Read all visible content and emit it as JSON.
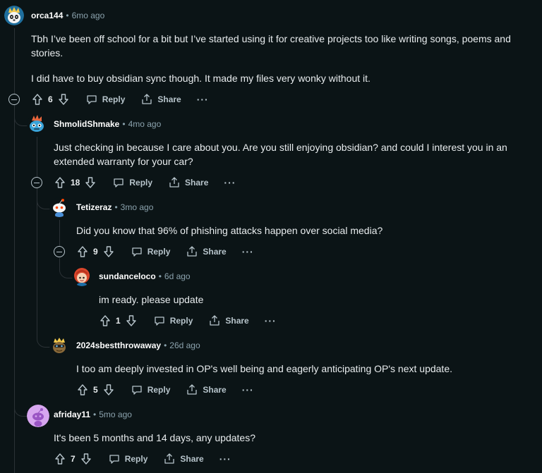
{
  "comments": [
    {
      "username": "orca144",
      "time": "6mo ago",
      "avatar_icon": "panda-avatar-icon",
      "paragraphs": [
        "Tbh I’ve been off school for a bit but I’ve started using it for creative projects too like writing songs, poems and stories.",
        "I did have to buy obsidian sync though. It made my files very wonky without it."
      ],
      "votes": "6"
    },
    {
      "username": "ShmolidShmake",
      "time": "4mo ago",
      "avatar_icon": "robot-avatar-icon",
      "paragraphs": [
        "Just checking in because I care about you. Are you still enjoying obsidian? and could I interest you in an extended warranty for your car?"
      ],
      "votes": "18"
    },
    {
      "username": "Tetizeraz",
      "time": "3mo ago",
      "avatar_icon": "snoo-avatar-icon",
      "paragraphs": [
        "Did you know that 96% of phishing attacks happen over social media?"
      ],
      "votes": "9"
    },
    {
      "username": "sundanceloco",
      "time": "6d ago",
      "avatar_icon": "red-hair-avatar-icon",
      "paragraphs": [
        "im ready. please update"
      ],
      "votes": "1"
    },
    {
      "username": "2024sbestthrowaway",
      "time": "26d ago",
      "avatar_icon": "crowned-avatar-icon",
      "paragraphs": [
        "I too am deeply invested in OP's well being and eagerly anticipating OP's next update."
      ],
      "votes": "5"
    },
    {
      "username": "afriday11",
      "time": "5mo ago",
      "avatar_icon": "default-snoo-avatar-icon",
      "paragraphs": [
        "It's been 5 months and 14 days, any updates?"
      ],
      "votes": "7"
    }
  ],
  "actions": {
    "reply_label": "Reply",
    "share_label": "Share",
    "more_label": "···",
    "separator": "•"
  },
  "colors": {
    "background": "#0b1416",
    "text": "#e8ecee",
    "muted": "#8ba2ad",
    "thread_line": "#2b3236"
  }
}
